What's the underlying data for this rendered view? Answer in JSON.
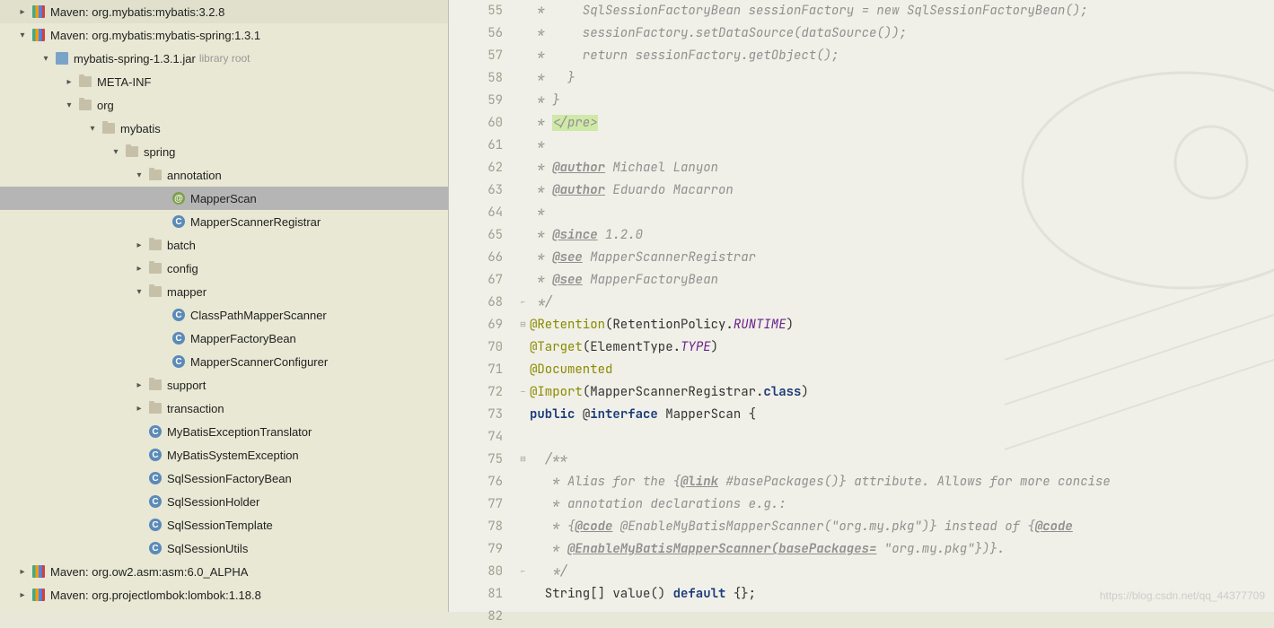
{
  "sidebar": {
    "items": [
      {
        "level": 0,
        "arrow": ">",
        "icon": "lib",
        "label": "Maven: org.mybatis:mybatis:3.2.8"
      },
      {
        "level": 0,
        "arrow": "v",
        "icon": "lib",
        "label": "Maven: org.mybatis:mybatis-spring:1.3.1"
      },
      {
        "level": 1,
        "arrow": "v",
        "icon": "jar",
        "label": "mybatis-spring-1.3.1.jar",
        "suffix": "library root"
      },
      {
        "level": 2,
        "arrow": ">",
        "icon": "folder",
        "label": "META-INF"
      },
      {
        "level": 2,
        "arrow": "v",
        "icon": "folder",
        "label": "org"
      },
      {
        "level": 3,
        "arrow": "v",
        "icon": "folder",
        "label": "mybatis"
      },
      {
        "level": 4,
        "arrow": "v",
        "icon": "folder",
        "label": "spring"
      },
      {
        "level": 5,
        "arrow": "v",
        "icon": "folder",
        "label": "annotation"
      },
      {
        "level": 6,
        "arrow": "",
        "icon": "at",
        "label": "MapperScan",
        "selected": true
      },
      {
        "level": 6,
        "arrow": "",
        "icon": "class",
        "label": "MapperScannerRegistrar"
      },
      {
        "level": 5,
        "arrow": ">",
        "icon": "folder",
        "label": "batch"
      },
      {
        "level": 5,
        "arrow": ">",
        "icon": "folder",
        "label": "config"
      },
      {
        "level": 5,
        "arrow": "v",
        "icon": "folder",
        "label": "mapper"
      },
      {
        "level": 6,
        "arrow": "",
        "icon": "class",
        "label": "ClassPathMapperScanner"
      },
      {
        "level": 6,
        "arrow": "",
        "icon": "class",
        "label": "MapperFactoryBean"
      },
      {
        "level": 6,
        "arrow": "",
        "icon": "class",
        "label": "MapperScannerConfigurer"
      },
      {
        "level": 5,
        "arrow": ">",
        "icon": "folder",
        "label": "support"
      },
      {
        "level": 5,
        "arrow": ">",
        "icon": "folder",
        "label": "transaction"
      },
      {
        "level": 5,
        "arrow": "",
        "icon": "class",
        "label": "MyBatisExceptionTranslator"
      },
      {
        "level": 5,
        "arrow": "",
        "icon": "class",
        "label": "MyBatisSystemException"
      },
      {
        "level": 5,
        "arrow": "",
        "icon": "class",
        "label": "SqlSessionFactoryBean"
      },
      {
        "level": 5,
        "arrow": "",
        "icon": "class",
        "label": "SqlSessionHolder"
      },
      {
        "level": 5,
        "arrow": "",
        "icon": "class",
        "label": "SqlSessionTemplate"
      },
      {
        "level": 5,
        "arrow": "",
        "icon": "class",
        "label": "SqlSessionUtils"
      },
      {
        "level": 0,
        "arrow": ">",
        "icon": "lib",
        "label": "Maven: org.ow2.asm:asm:6.0_ALPHA"
      },
      {
        "level": 0,
        "arrow": ">",
        "icon": "lib",
        "label": "Maven: org.projectlombok:lombok:1.18.8"
      }
    ]
  },
  "editor": {
    "startLine": 55,
    "lines": [
      {
        "n": 55,
        "t": "comment",
        "text": " *     SqlSessionFactoryBean sessionFactory = new SqlSessionFactoryBean();"
      },
      {
        "n": 56,
        "t": "comment",
        "text": " *     sessionFactory.setDataSource(dataSource());"
      },
      {
        "n": 57,
        "t": "comment",
        "text": " *     return sessionFactory.getObject();"
      },
      {
        "n": 58,
        "t": "comment",
        "text": " *   }"
      },
      {
        "n": 59,
        "t": "comment",
        "text": " * }"
      },
      {
        "n": 60,
        "t": "comment_hi",
        "pre": " * ",
        "hi": "</pre>"
      },
      {
        "n": 61,
        "t": "comment",
        "text": " *"
      },
      {
        "n": 62,
        "t": "author",
        "name": "Michael Lanyon"
      },
      {
        "n": 63,
        "t": "author",
        "name": "Eduardo Macarron"
      },
      {
        "n": 64,
        "t": "comment",
        "text": " *"
      },
      {
        "n": 65,
        "t": "since",
        "ver": "1.2.0"
      },
      {
        "n": 66,
        "t": "see",
        "ref": "MapperScannerRegistrar"
      },
      {
        "n": 67,
        "t": "see",
        "ref": "MapperFactoryBean"
      },
      {
        "n": 68,
        "t": "comment",
        "text": " */",
        "fold": "end"
      },
      {
        "n": 69,
        "t": "retention",
        "fold": "start"
      },
      {
        "n": 70,
        "t": "target"
      },
      {
        "n": 71,
        "t": "documented"
      },
      {
        "n": 72,
        "t": "import",
        "fold": "mark"
      },
      {
        "n": 73,
        "t": "decl"
      },
      {
        "n": 74,
        "t": "blank"
      },
      {
        "n": 75,
        "t": "comment",
        "text": "  /**",
        "fold": "start"
      },
      {
        "n": 76,
        "t": "doc_link"
      },
      {
        "n": 77,
        "t": "comment",
        "text": "   * annotation declarations e.g.:"
      },
      {
        "n": 78,
        "t": "doc_code1"
      },
      {
        "n": 79,
        "t": "doc_code2"
      },
      {
        "n": 80,
        "t": "comment",
        "text": "   */",
        "fold": "end"
      },
      {
        "n": 81,
        "t": "value_decl"
      },
      {
        "n": 82,
        "t": "blank"
      }
    ],
    "retention": {
      "ann": "@Retention",
      "open": "(",
      "cls": "RetentionPolicy",
      "dot": ".",
      "val": "RUNTIME",
      "close": ")"
    },
    "target": {
      "ann": "@Target",
      "open": "(",
      "cls": "ElementType",
      "dot": ".",
      "val": "TYPE",
      "close": ")"
    },
    "documented": "@Documented",
    "import": {
      "ann": "@Import",
      "open": "(",
      "cls": "MapperScannerRegistrar",
      "dot": ".",
      "kw": "class",
      "close": ")"
    },
    "decl": {
      "pub": "public ",
      "at": "@",
      "intf": "interface ",
      "name": "MapperScan ",
      "brace": "{"
    },
    "doc_link": {
      "pre": "   * Alias for the {",
      "tag": "@link",
      "mid": " #basePackages()",
      "post": "} attribute. Allows for more concise"
    },
    "doc_code1": {
      "pre": "   * {",
      "tag": "@code",
      "mid": " @EnableMyBatisMapperScanner(\"org.my.pkg\")}",
      "post": " instead of {",
      "tag2": "@code"
    },
    "doc_code2": {
      "pre": "   * ",
      "tag": "@EnableMyBatisMapperScanner(basePackages=",
      "mid": " \"org.my.pkg\"}",
      ")}.": ")}."
    },
    "value_decl": {
      "pre": "  String[] value() ",
      "kw": "default ",
      "post": "{};"
    }
  },
  "watermark": "https://blog.csdn.net/qq_44377709"
}
